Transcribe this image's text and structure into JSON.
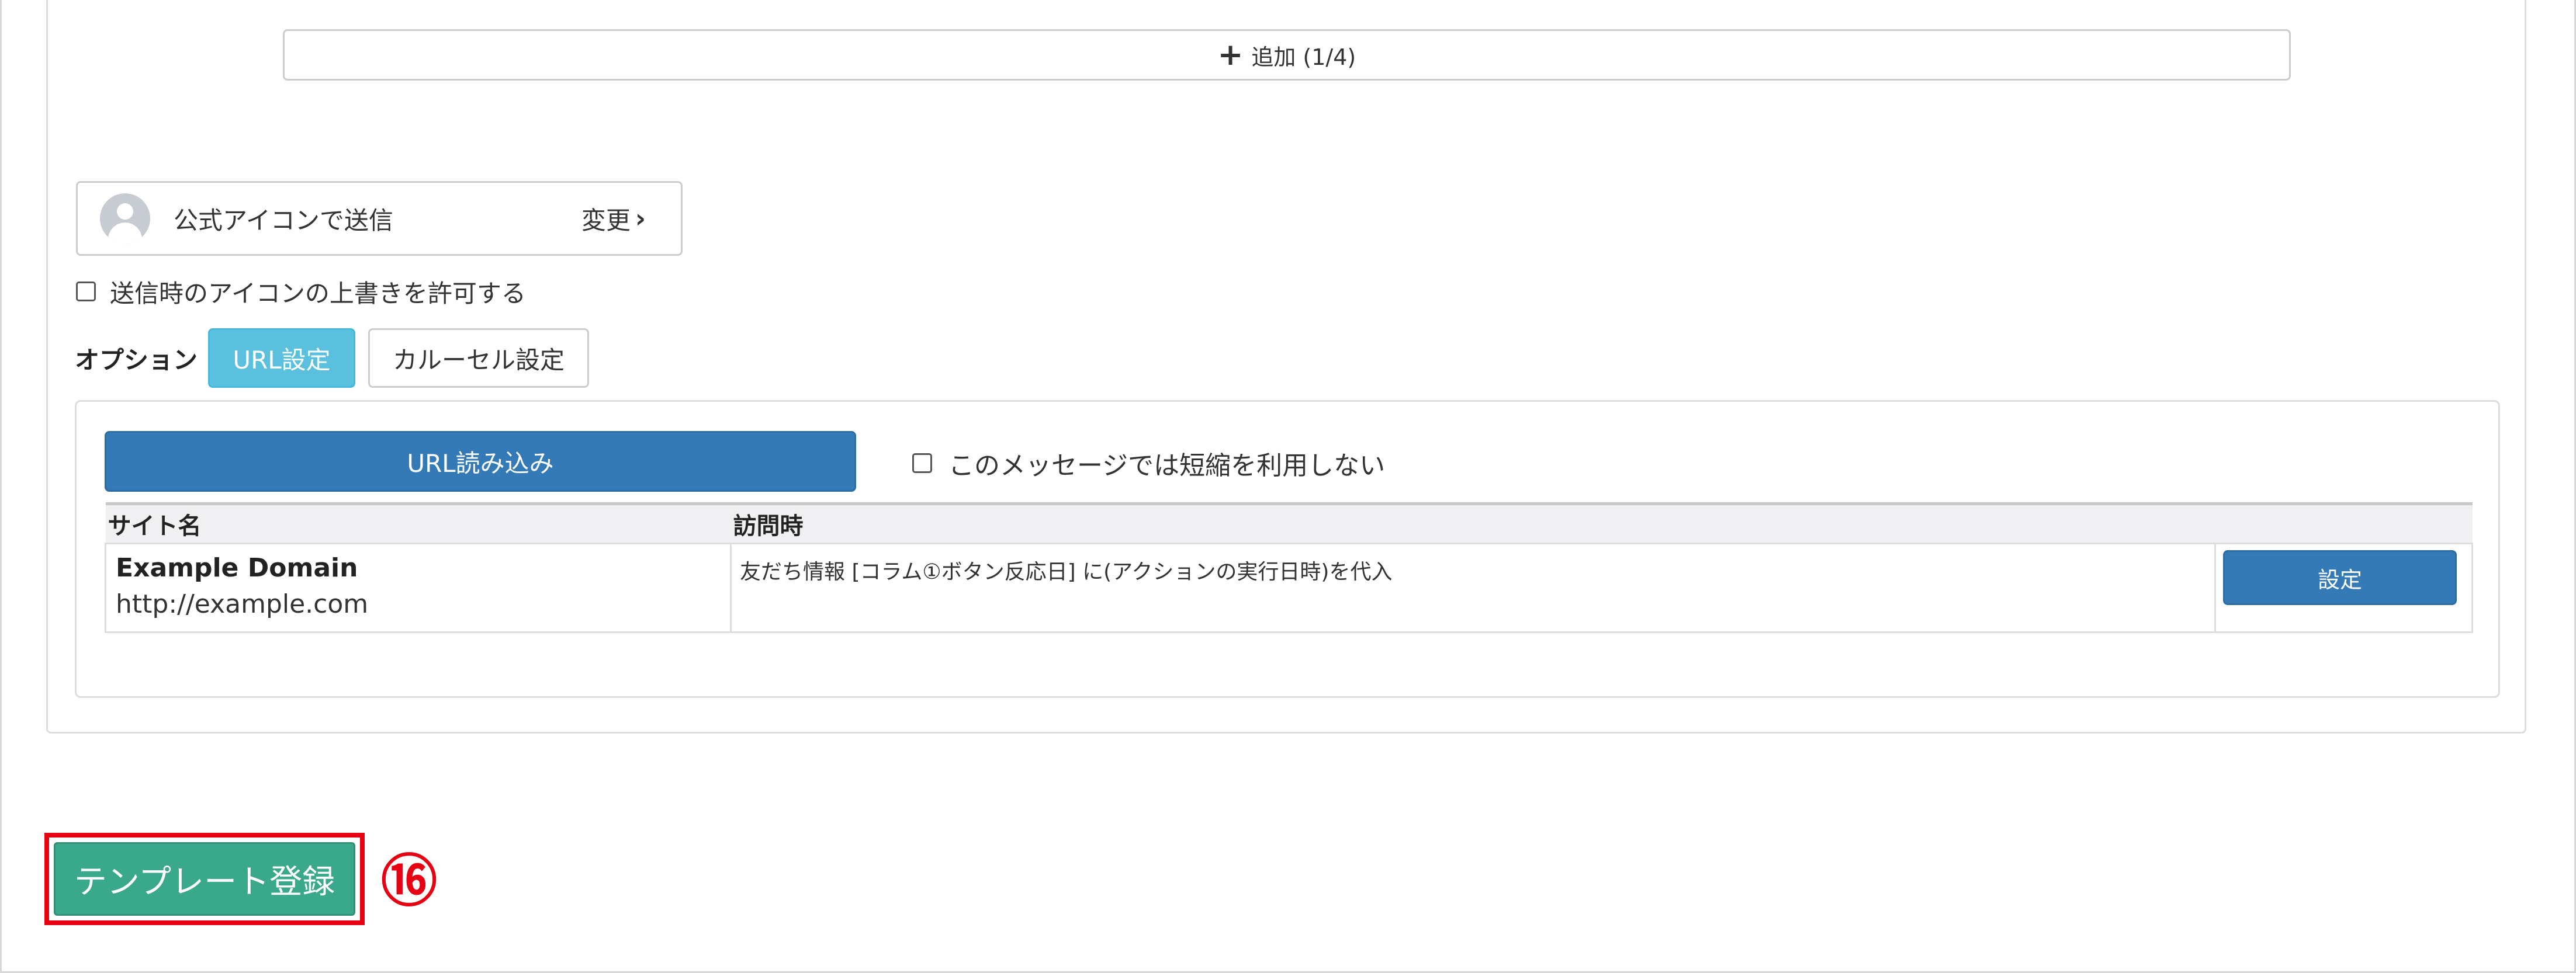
{
  "add_button": {
    "icon": "plus-icon",
    "label": "追加 (1/4)"
  },
  "icon_setting": {
    "avatar_icon": "user-avatar-icon",
    "label": "公式アイコンで送信",
    "change_label": "変更",
    "change_icon": "chevron-right-icon"
  },
  "override_checkbox": {
    "label": "送信時のアイコンの上書きを許可する",
    "checked": false
  },
  "options": {
    "label": "オプション",
    "url_button": "URL設定",
    "carousel_button": "カルーセル設定"
  },
  "url_panel": {
    "load_button": "URL読み込み",
    "no_shorten": {
      "label": "このメッセージでは短縮を利用しない",
      "checked": false
    },
    "table": {
      "headers": [
        "サイト名",
        "訪問時",
        ""
      ],
      "rows": [
        {
          "site_name": "Example Domain",
          "site_url": "http://example.com",
          "visit_action": "友だち情報 [コラム①ボタン反応日] に(アクションの実行日時)を代入",
          "setting_button": "設定"
        }
      ]
    }
  },
  "register_button": "テンプレート登録",
  "step_marker": "⑯",
  "colors": {
    "primary": "#337ab7",
    "info": "#5bc0de",
    "success": "#3aa88a",
    "highlight": "#e60012"
  }
}
